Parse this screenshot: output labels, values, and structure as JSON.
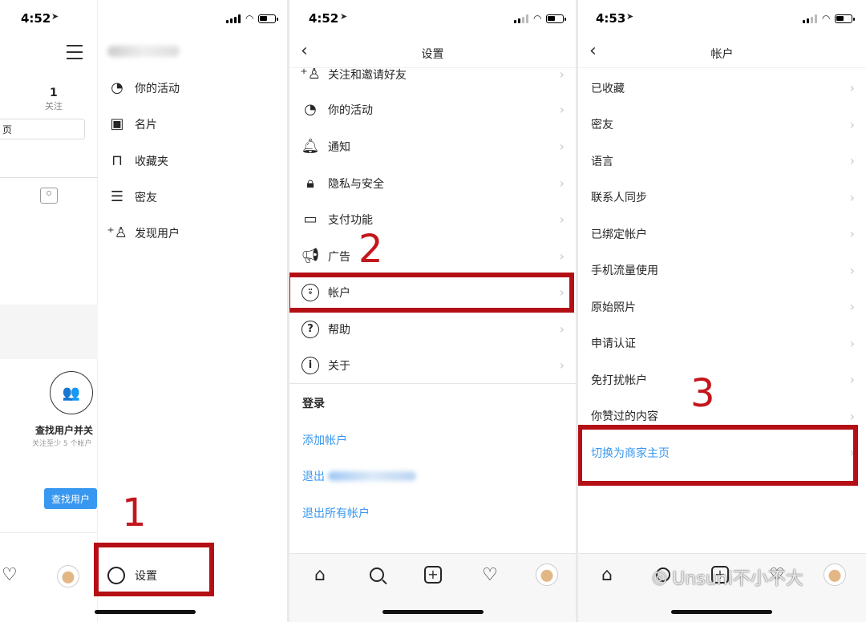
{
  "panel1": {
    "status_time": "4:52",
    "followers_count": "1",
    "followers_label": "关注",
    "partial_tab": "页",
    "find_users_title": "查找用户并关",
    "find_users_sub": "关注至少 5 个帐户",
    "find_users_button": "查找用户",
    "menu": [
      {
        "label": "你的活动",
        "icon": "activity-icon"
      },
      {
        "label": "名片",
        "icon": "nametag-icon"
      },
      {
        "label": "收藏夹",
        "icon": "bookmark-icon"
      },
      {
        "label": "密友",
        "icon": "close-friends-icon"
      },
      {
        "label": "发现用户",
        "icon": "add-user-icon"
      }
    ],
    "settings_label": "设置",
    "annotation": "1"
  },
  "panel2": {
    "status_time": "4:52",
    "title": "设置",
    "rows": [
      {
        "label": "关注和邀请好友",
        "icon": "add-user-icon"
      },
      {
        "label": "你的活动",
        "icon": "activity-icon"
      },
      {
        "label": "通知",
        "icon": "bell-icon"
      },
      {
        "label": "隐私与安全",
        "icon": "lock-icon"
      },
      {
        "label": "支付功能",
        "icon": "card-icon"
      },
      {
        "label": "广告",
        "icon": "megaphone-icon"
      },
      {
        "label": "帐户",
        "icon": "account-icon"
      },
      {
        "label": "帮助",
        "icon": "help-icon"
      },
      {
        "label": "关于",
        "icon": "info-icon"
      }
    ],
    "login_header": "登录",
    "add_account": "添加帐户",
    "logout_prefix": "退出",
    "logout_all": "退出所有帐户",
    "annotation": "2"
  },
  "panel3": {
    "status_time": "4:53",
    "title": "帐户",
    "rows": [
      "已收藏",
      "密友",
      "语言",
      "联系人同步",
      "已绑定帐户",
      "手机流量使用",
      "原始照片",
      "申请认证",
      "免打扰帐户",
      "你赞过的内容"
    ],
    "switch_business": "切换为商家主页",
    "annotation": "3"
  },
  "watermark": "Unsuni不小不大",
  "colors": {
    "accent": "#3897f0",
    "annotation": "#c4161c",
    "box": "#b50f16"
  }
}
